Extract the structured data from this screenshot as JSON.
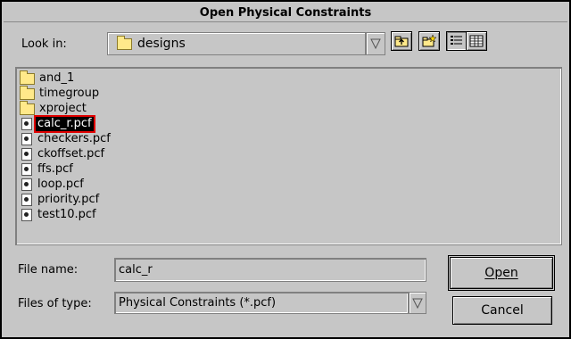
{
  "window": {
    "title": "Open Physical Constraints"
  },
  "look_in": {
    "label": "Look in:",
    "value": "designs"
  },
  "toolbar": {
    "icons": [
      "up-one-level-icon",
      "create-new-folder-icon",
      "list-view-icon",
      "details-view-icon"
    ]
  },
  "files": [
    {
      "name": "and_1",
      "type": "folder"
    },
    {
      "name": "timegroup",
      "type": "folder"
    },
    {
      "name": "xproject",
      "type": "folder"
    },
    {
      "name": "calc_r.pcf",
      "type": "file",
      "selected": true
    },
    {
      "name": "checkers.pcf",
      "type": "file"
    },
    {
      "name": "ckoffset.pcf",
      "type": "file"
    },
    {
      "name": "ffs.pcf",
      "type": "file"
    },
    {
      "name": "loop.pcf",
      "type": "file"
    },
    {
      "name": "priority.pcf",
      "type": "file"
    },
    {
      "name": "test10.pcf",
      "type": "file"
    }
  ],
  "file_name": {
    "label": "File name:",
    "value": "calc_r"
  },
  "files_of_type": {
    "label": "Files of type:",
    "value": "Physical Constraints (*.pcf)"
  },
  "buttons": {
    "open": "Open",
    "cancel": "Cancel"
  }
}
